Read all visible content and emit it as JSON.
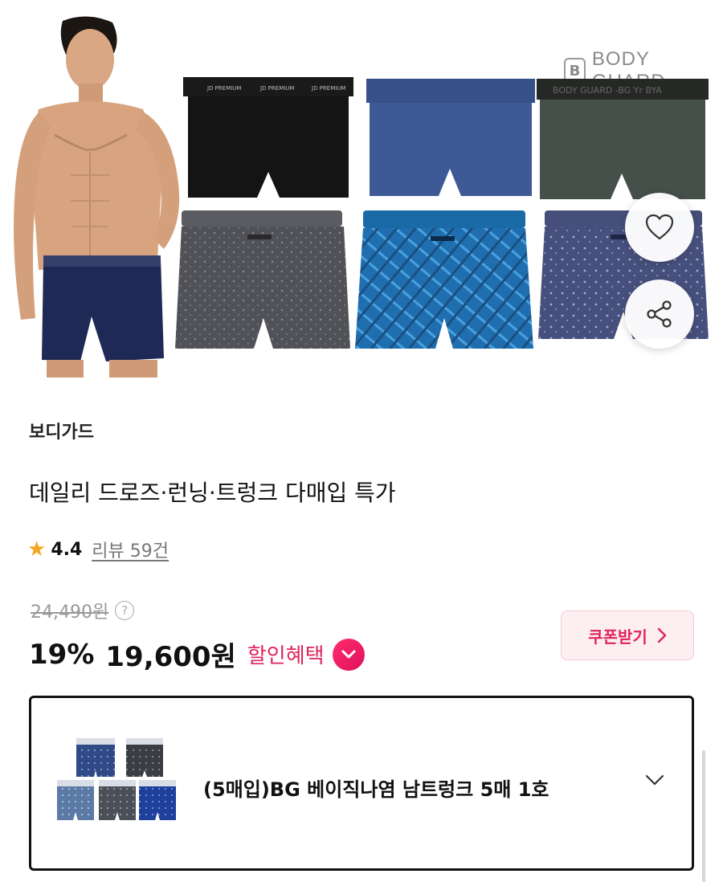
{
  "hero": {
    "brand_logo_text": "BODY GUARD",
    "brand_logo_mark": "B",
    "wishlist_icon": "heart-icon",
    "share_icon": "share-icon"
  },
  "product": {
    "brand": "보디가드",
    "title": "데일리 드로즈·런닝·트렁크 다매입 특가",
    "rating_icon": "star-icon",
    "rating": "4.4",
    "reviews": "리뷰 59건"
  },
  "pricing": {
    "original_price": "24,490원",
    "help_symbol": "?",
    "discount": "19%",
    "price": "19,600원",
    "benefit_label": "할인혜택",
    "coupon_label": "쿠폰받기",
    "colors": {
      "accent": "#e0245e",
      "coupon_bg": "#fdeef1"
    }
  },
  "option": {
    "selected_label": "(5매입)BG 베이직나염 남트렁크 5매 1호"
  }
}
